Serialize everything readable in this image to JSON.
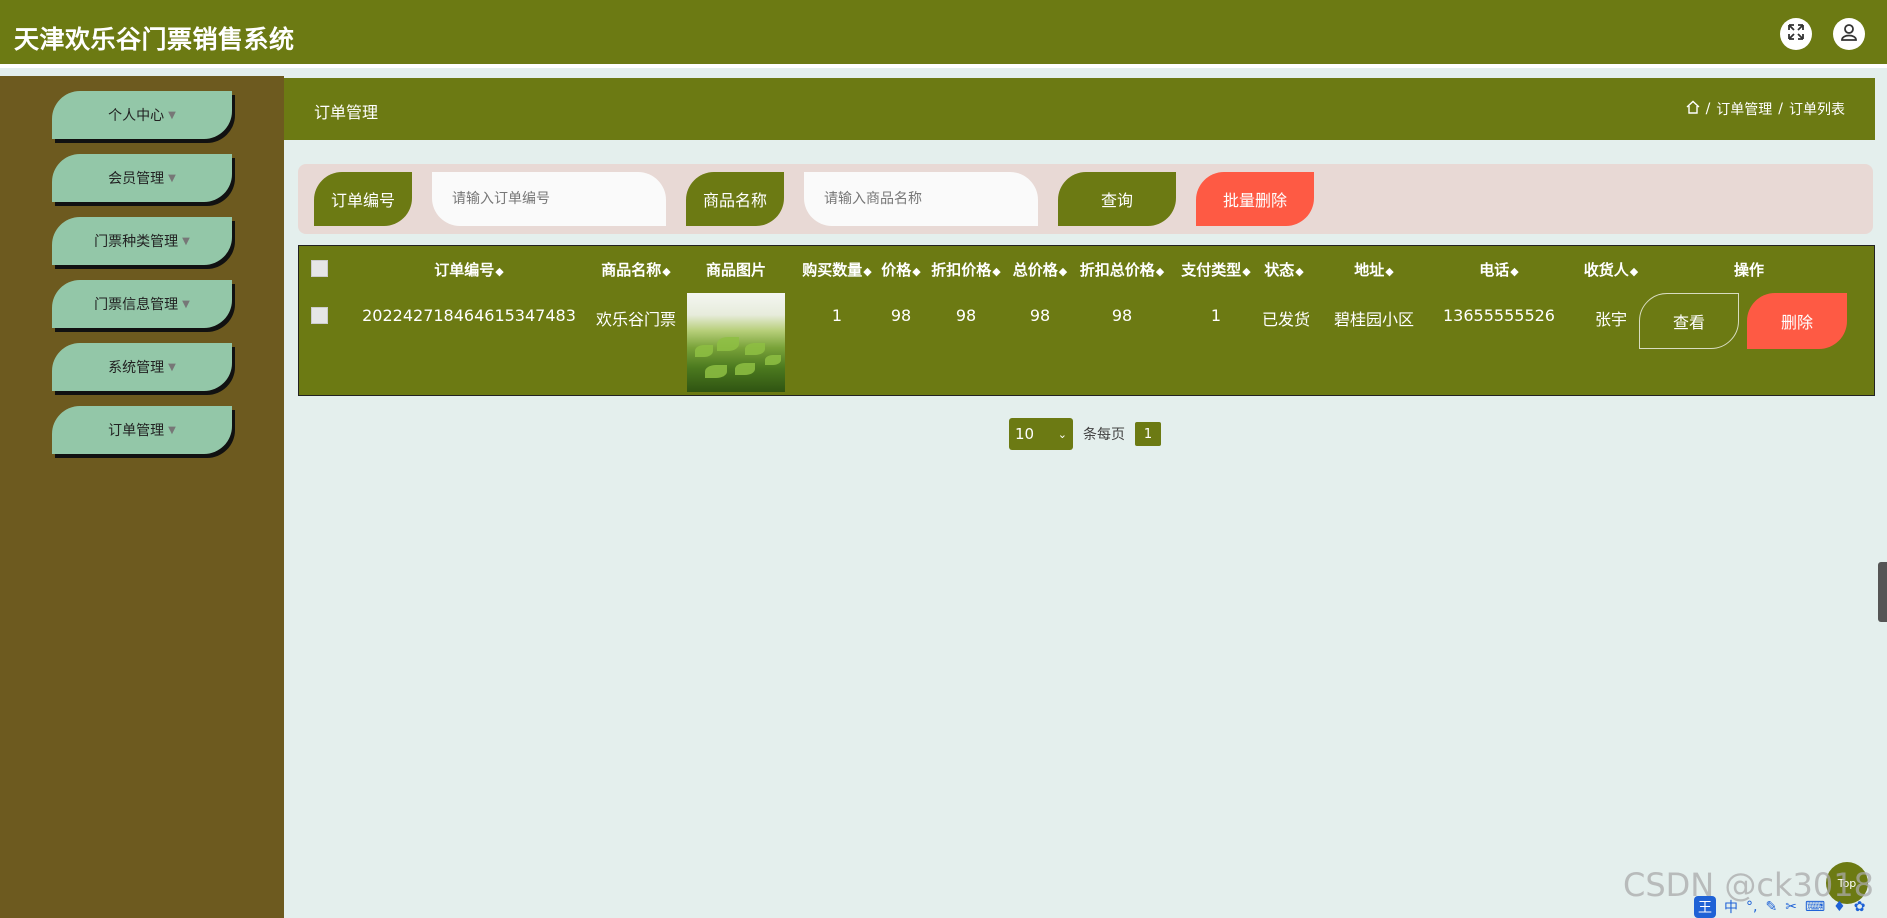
{
  "header": {
    "title": "天津欢乐谷门票销售系统"
  },
  "sidebar": {
    "items": [
      {
        "label": "个人中心"
      },
      {
        "label": "会员管理"
      },
      {
        "label": "门票种类管理"
      },
      {
        "label": "门票信息管理"
      },
      {
        "label": "系统管理"
      },
      {
        "label": "订单管理"
      }
    ]
  },
  "page": {
    "title": "订单管理",
    "breadcrumb": [
      "订单管理",
      "订单列表"
    ]
  },
  "search": {
    "order_no_label": "订单编号",
    "order_no_placeholder": "请输入订单编号",
    "product_label": "商品名称",
    "product_placeholder": "请输入商品名称",
    "query_label": "查询",
    "batch_delete_label": "批量删除"
  },
  "table": {
    "columns": [
      "订单编号",
      "商品名称",
      "商品图片",
      "购买数量",
      "价格",
      "折扣价格",
      "总价格",
      "折扣总价格",
      "支付类型",
      "状态",
      "地址",
      "电话",
      "收货人",
      "操作"
    ],
    "rows": [
      {
        "order_no": "202242718464615347483",
        "product_name": "欢乐谷门票",
        "quantity": "1",
        "price": "98",
        "discount_price": "98",
        "total_price": "98",
        "discount_total": "98",
        "pay_type": "1",
        "status": "已发货",
        "address": "碧桂园小区",
        "phone": "13655555526",
        "receiver": "张宇",
        "view_label": "查看",
        "delete_label": "删除"
      }
    ]
  },
  "pagination": {
    "page_size": "10",
    "per_page_label": "条每页",
    "current_page": "1"
  },
  "watermark": "CSDN @ck3018",
  "top_button": "Top",
  "ime": {
    "logo": "王",
    "mode": "中"
  },
  "colors": {
    "primary": "#6c7a13",
    "sidebar": "#6d5a1f",
    "menu": "#93c7a8",
    "danger": "#fe5a44",
    "background": "#e4efed"
  }
}
